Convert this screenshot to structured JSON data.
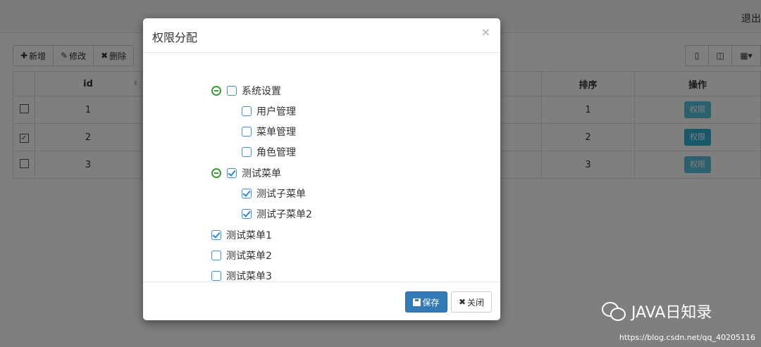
{
  "header": {
    "logout": "退出"
  },
  "toolbar": {
    "add": "新增",
    "edit": "修改",
    "delete": "删除"
  },
  "table": {
    "headers": {
      "id": "id",
      "order": "排序",
      "action": "操作"
    },
    "rows": [
      {
        "id": "1",
        "order": "1",
        "checked": false,
        "action": "权限"
      },
      {
        "id": "2",
        "order": "2",
        "checked": true,
        "action": "权限"
      },
      {
        "id": "3",
        "order": "3",
        "checked": false,
        "action": "权限"
      }
    ]
  },
  "modal": {
    "title": "权限分配",
    "close": "×",
    "tree": [
      {
        "label": "系统设置",
        "checked": false,
        "expanded": true
      },
      {
        "label": "用户管理",
        "checked": false
      },
      {
        "label": "菜单管理",
        "checked": false
      },
      {
        "label": "角色管理",
        "checked": false
      },
      {
        "label": "测试菜单",
        "checked": true,
        "expanded": true
      },
      {
        "label": "测试子菜单",
        "checked": true
      },
      {
        "label": "测试子菜单2",
        "checked": true
      },
      {
        "label": "测试菜单1",
        "checked": true
      },
      {
        "label": "测试菜单2",
        "checked": false
      },
      {
        "label": "测试菜单3",
        "checked": false
      }
    ],
    "save": "保存",
    "cancel": "关闭"
  },
  "watermark": {
    "brand": "JAVA日知录",
    "url": "https://blog.csdn.net/qq_40205116"
  },
  "colors": {
    "primary": "#337ab7",
    "info": "#5bc0de",
    "tree_check": "#2a86d8",
    "tree_toggle": "#3c9a3c"
  }
}
